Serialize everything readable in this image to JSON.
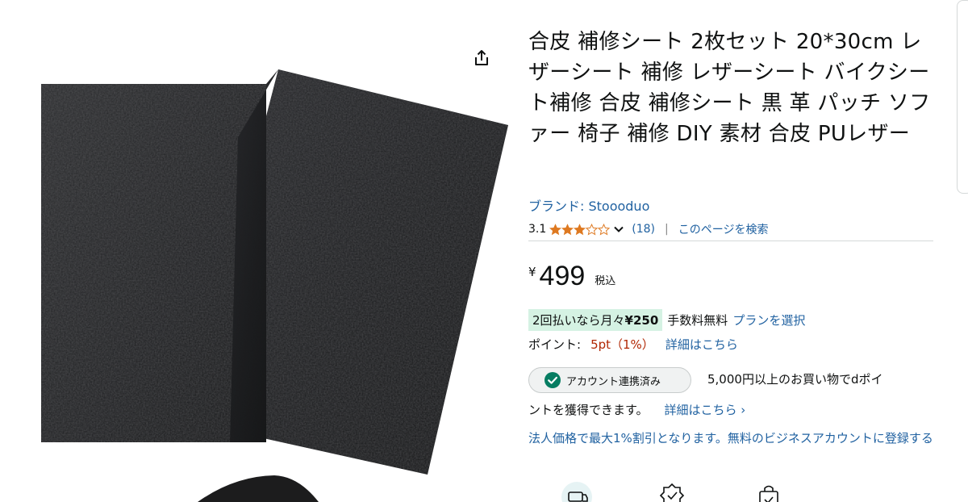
{
  "product": {
    "title": "合皮 補修シート 2枚セット 20*30cm レザーシート 補修 レザーシート バイクシート補修 合皮 補修シート 黒 革 パッチ ソファー 椅子 補修 DIY 素材 合皮 PUレザー",
    "brand": "ブランド: Stoooduo"
  },
  "rating": {
    "value": "3.1",
    "stars": 3,
    "max": 5,
    "count": "(18)",
    "separator": "|",
    "search_page": "このページを検索"
  },
  "price": {
    "currency": "¥",
    "amount": "499",
    "tax_label": "税込"
  },
  "installment": {
    "prefix": "2回払いなら月々",
    "amount": "¥250",
    "fee": "手数料無料",
    "plan_link": "プランを選択"
  },
  "points": {
    "label": "ポイント:",
    "value": "5pt（1%）",
    "detail_link": "詳細はこちら"
  },
  "dpoint": {
    "badge": "アカウント連携済み",
    "line1": "5,000円以上のお買い物でdポイ",
    "line2": "ントを獲得できます。",
    "detail_link": "詳細はこちら ›"
  },
  "business": {
    "link": "法人価格で最大1%割引となります。無料のビジネスアカウントに登録する"
  },
  "icons": {
    "share": "share-icon",
    "star": "star-icon",
    "chevron": "chevron-down-icon",
    "check": "check-circle-icon",
    "features": [
      "delivery-icon",
      "badge-icon",
      "bag-icon"
    ]
  },
  "colors": {
    "link": "#2162a1",
    "price_red": "#b12704",
    "star": "#de7921",
    "install_bg": "#d5f2e3",
    "check_green": "#067d62"
  }
}
